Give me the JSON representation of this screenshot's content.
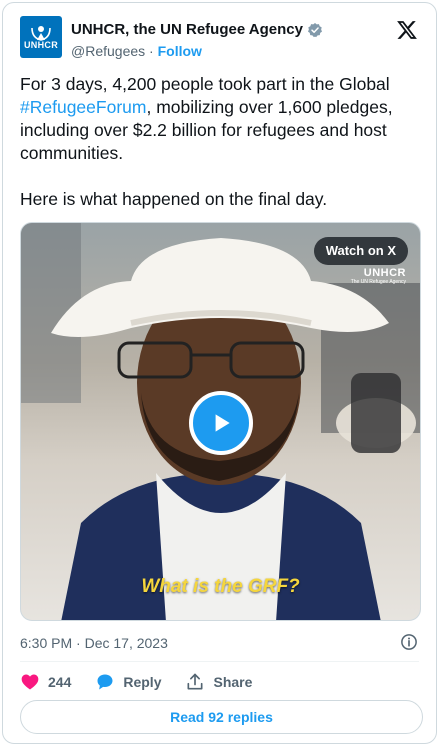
{
  "author": {
    "logo_text": "UNHCR",
    "display_name": "UNHCR, the UN Refugee Agency",
    "handle": "@Refugees",
    "separator": " · ",
    "follow_label": "Follow",
    "brand_color": "#0072bc",
    "verified_icon": "verified-badge-icon"
  },
  "tweet": {
    "text_before_hashtag": "For 3 days, 4,200 people took part in the Global ",
    "hashtag": "#RefugeeForum",
    "text_after_hashtag": ", mobilizing over 1,600 pledges, including over $2.2 billion for refugees and host communities.\n\nHere is what happened on the final day."
  },
  "media": {
    "watch_label": "Watch on X",
    "watermark_main": "UNHCR",
    "watermark_sub": "The UN Refugee Agency",
    "caption": "What is the GRF?",
    "caption_color": "#f5d63d",
    "play_icon": "play-icon"
  },
  "meta": {
    "timestamp": "6:30 PM · Dec 17, 2023"
  },
  "actions": {
    "like_count": "244",
    "reply_label": "Reply",
    "share_label": "Share",
    "like_color": "#f91880",
    "reply_color": "#1d9bf0"
  },
  "replies": {
    "label": "Read 92 replies",
    "accent": "#1d9bf0"
  }
}
